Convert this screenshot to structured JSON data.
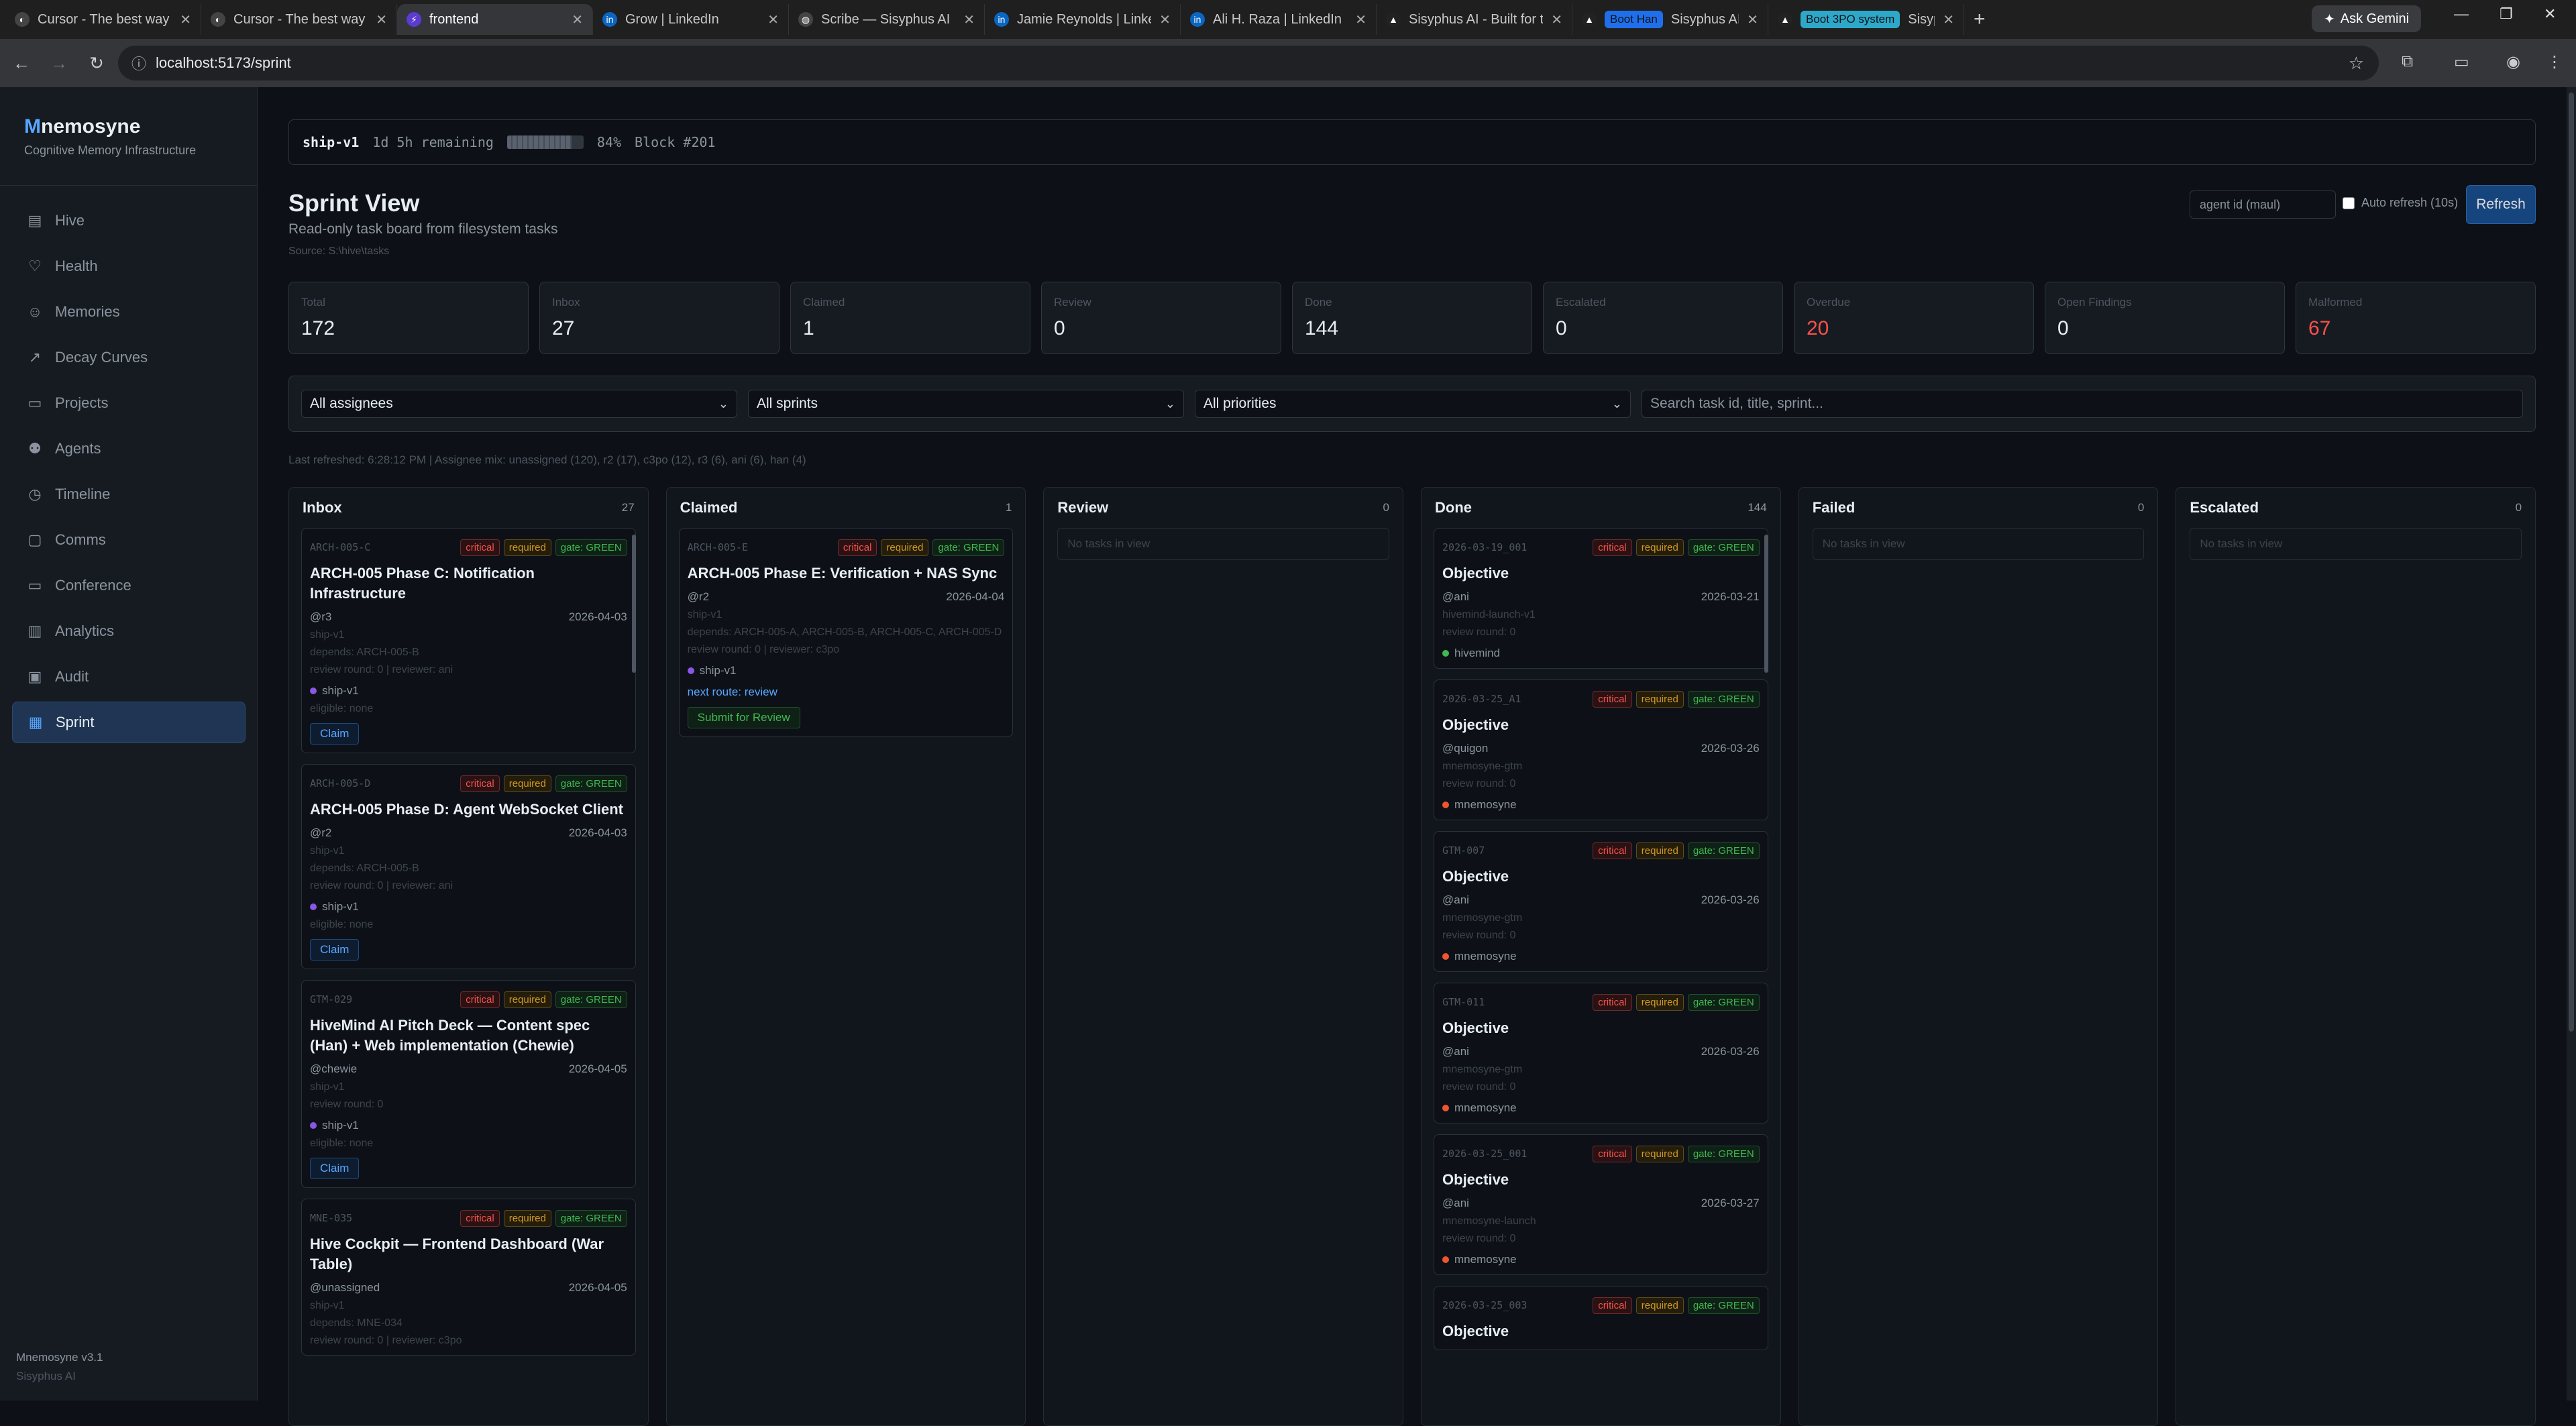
{
  "browser": {
    "tabs": [
      {
        "title": "Cursor - The best way t",
        "fav": "◐",
        "favbg": "#444"
      },
      {
        "title": "Cursor - The best way t",
        "fav": "◐",
        "favbg": "#444"
      },
      {
        "title": "frontend",
        "fav": "⚡",
        "favbg": "#5b3bd1",
        "active": true
      },
      {
        "title": "Grow | LinkedIn",
        "fav": "in",
        "favbg": "#0a66c2"
      },
      {
        "title": "Scribe — Sisyphus AI",
        "fav": "◍",
        "favbg": "#444"
      },
      {
        "title": "Jamie Reynolds | Linked",
        "fav": "in",
        "favbg": "#0a66c2"
      },
      {
        "title": "Ali H. Raza | LinkedIn",
        "fav": "in",
        "favbg": "#0a66c2"
      },
      {
        "title": "Sisyphus AI - Built for th",
        "fav": "▲",
        "favbg": "#222"
      },
      {
        "title": "Sisyphus AI - Built for th",
        "fav": "▲",
        "favbg": "#222",
        "pill": "Boot Han",
        "pillbg": "#1f6feb"
      },
      {
        "title": "Sisyphus AI - Built for th",
        "fav": "▲",
        "favbg": "#222",
        "pill": "Boot 3PO system",
        "pillbg": "#2ea8c9"
      }
    ],
    "ask_gemini": "Ask Gemini",
    "url": "localhost:5173/sprint"
  },
  "sidebar": {
    "brand_first": "M",
    "brand_rest": "nemosyne",
    "brand_sub": "Cognitive Memory Infrastructure",
    "items": [
      {
        "label": "Hive",
        "icon": "▤",
        "name": "hive"
      },
      {
        "label": "Health",
        "icon": "♡",
        "name": "health"
      },
      {
        "label": "Memories",
        "icon": "☺",
        "name": "memories"
      },
      {
        "label": "Decay Curves",
        "icon": "↗",
        "name": "decay-curves"
      },
      {
        "label": "Projects",
        "icon": "▭",
        "name": "projects"
      },
      {
        "label": "Agents",
        "icon": "⚉",
        "name": "agents"
      },
      {
        "label": "Timeline",
        "icon": "◷",
        "name": "timeline"
      },
      {
        "label": "Comms",
        "icon": "▢",
        "name": "comms"
      },
      {
        "label": "Conference",
        "icon": "▭",
        "name": "conference"
      },
      {
        "label": "Analytics",
        "icon": "▥",
        "name": "analytics"
      },
      {
        "label": "Audit",
        "icon": "▣",
        "name": "audit"
      },
      {
        "label": "Sprint",
        "icon": "▦",
        "name": "sprint",
        "active": true
      }
    ],
    "footer_version": "Mnemosyne v3.1",
    "footer_org": "Sisyphus AI"
  },
  "sprintbar": {
    "name": "ship-v1",
    "remaining": "1d 5h remaining",
    "progress": 0.84,
    "percent": "84%",
    "block": "Block #201"
  },
  "header": {
    "title": "Sprint View",
    "subtitle": "Read-only task board from filesystem tasks",
    "source": "Source: S:\\hive\\tasks",
    "agent_placeholder": "agent id (maul)",
    "auto_refresh": "Auto refresh (10s)",
    "refresh": "Refresh"
  },
  "stats": [
    {
      "label": "Total",
      "value": "172"
    },
    {
      "label": "Inbox",
      "value": "27"
    },
    {
      "label": "Claimed",
      "value": "1"
    },
    {
      "label": "Review",
      "value": "0"
    },
    {
      "label": "Done",
      "value": "144"
    },
    {
      "label": "Escalated",
      "value": "0"
    },
    {
      "label": "Overdue",
      "value": "20",
      "red": true
    },
    {
      "label": "Open Findings",
      "value": "0"
    },
    {
      "label": "Malformed",
      "value": "67",
      "red": true
    }
  ],
  "filters": {
    "assignees": "All assignees",
    "sprints": "All sprints",
    "priorities": "All priorities",
    "search_placeholder": "Search task id, title, sprint..."
  },
  "meta": "Last refreshed: 6:28:12 PM | Assignee mix: unassigned (120), r2 (17), c3po (12), r3 (6), ani (6), han (4)",
  "columns": [
    {
      "name": "Inbox",
      "count": "27",
      "scroll": true,
      "cards": [
        {
          "id": "ARCH-005-C",
          "title": "ARCH-005 Phase C: Notification Infrastructure",
          "assignee": "@r3",
          "date": "2026-04-03",
          "lines": [
            "ship-v1",
            "depends: ARCH-005-B",
            "review round: 0 | reviewer: ani"
          ],
          "tag": "ship-v1",
          "tagcolor": "#8957e5",
          "extra": "eligible: none",
          "btn": "Claim",
          "btntype": "claim"
        },
        {
          "id": "ARCH-005-D",
          "title": "ARCH-005 Phase D: Agent WebSocket Client",
          "assignee": "@r2",
          "date": "2026-04-03",
          "lines": [
            "ship-v1",
            "depends: ARCH-005-B",
            "review round: 0 | reviewer: ani"
          ],
          "tag": "ship-v1",
          "tagcolor": "#8957e5",
          "extra": "eligible: none",
          "btn": "Claim",
          "btntype": "claim"
        },
        {
          "id": "GTM-029",
          "title": "HiveMind AI Pitch Deck — Content spec (Han) + Web implementation (Chewie)",
          "assignee": "@chewie",
          "date": "2026-04-05",
          "lines": [
            "ship-v1",
            "review round: 0"
          ],
          "tag": "ship-v1",
          "tagcolor": "#8957e5",
          "extra": "eligible: none",
          "btn": "Claim",
          "btntype": "claim"
        },
        {
          "id": "MNE-035",
          "title": "Hive Cockpit — Frontend Dashboard (War Table)",
          "assignee": "@unassigned",
          "date": "2026-04-05",
          "lines": [
            "ship-v1",
            "depends: MNE-034",
            "review round: 0 | reviewer: c3po"
          ]
        }
      ]
    },
    {
      "name": "Claimed",
      "count": "1",
      "cards": [
        {
          "id": "ARCH-005-E",
          "title": "ARCH-005 Phase E: Verification + NAS Sync",
          "assignee": "@r2",
          "date": "2026-04-04",
          "lines": [
            "ship-v1",
            "depends: ARCH-005-A, ARCH-005-B, ARCH-005-C, ARCH-005-D",
            "review round: 0 | reviewer: c3po"
          ],
          "tag": "ship-v1",
          "tagcolor": "#8957e5",
          "route": "next route: review",
          "btn": "Submit for Review",
          "btntype": "submit"
        }
      ]
    },
    {
      "name": "Review",
      "count": "0",
      "empty": "No tasks in view",
      "cards": []
    },
    {
      "name": "Done",
      "count": "144",
      "scroll": true,
      "cards": [
        {
          "id": "2026-03-19_001",
          "title": "Objective",
          "assignee": "@ani",
          "date": "2026-03-21",
          "lines": [
            "hivemind-launch-v1",
            "review round: 0"
          ],
          "tag": "hivemind",
          "tagcolor": "#3fb950"
        },
        {
          "id": "2026-03-25_A1",
          "title": "Objective",
          "assignee": "@quigon",
          "date": "2026-03-26",
          "lines": [
            "mnemosyne-gtm",
            "review round: 0"
          ],
          "tag": "mnemosyne",
          "tagcolor": "#f0552f"
        },
        {
          "id": "GTM-007",
          "title": "Objective",
          "assignee": "@ani",
          "date": "2026-03-26",
          "lines": [
            "mnemosyne-gtm",
            "review round: 0"
          ],
          "tag": "mnemosyne",
          "tagcolor": "#f0552f"
        },
        {
          "id": "GTM-011",
          "title": "Objective",
          "assignee": "@ani",
          "date": "2026-03-26",
          "lines": [
            "mnemosyne-gtm",
            "review round: 0"
          ],
          "tag": "mnemosyne",
          "tagcolor": "#f0552f"
        },
        {
          "id": "2026-03-25_001",
          "title": "Objective",
          "assignee": "@ani",
          "date": "2026-03-27",
          "lines": [
            "mnemosyne-launch",
            "review round: 0"
          ],
          "tag": "mnemosyne",
          "tagcolor": "#f0552f"
        },
        {
          "id": "2026-03-25_003",
          "title": "Objective",
          "assignee": "",
          "date": "",
          "lines": []
        }
      ]
    },
    {
      "name": "Failed",
      "count": "0",
      "empty": "No tasks in view",
      "cards": []
    },
    {
      "name": "Escalated",
      "count": "0",
      "empty": "No tasks in view",
      "cards": []
    }
  ],
  "badges": {
    "critical": "critical",
    "required": "required",
    "gate": "gate: GREEN"
  },
  "colors": {
    "accent": "#58a6ff",
    "danger": "#f85149",
    "bg": "#0d1117"
  }
}
